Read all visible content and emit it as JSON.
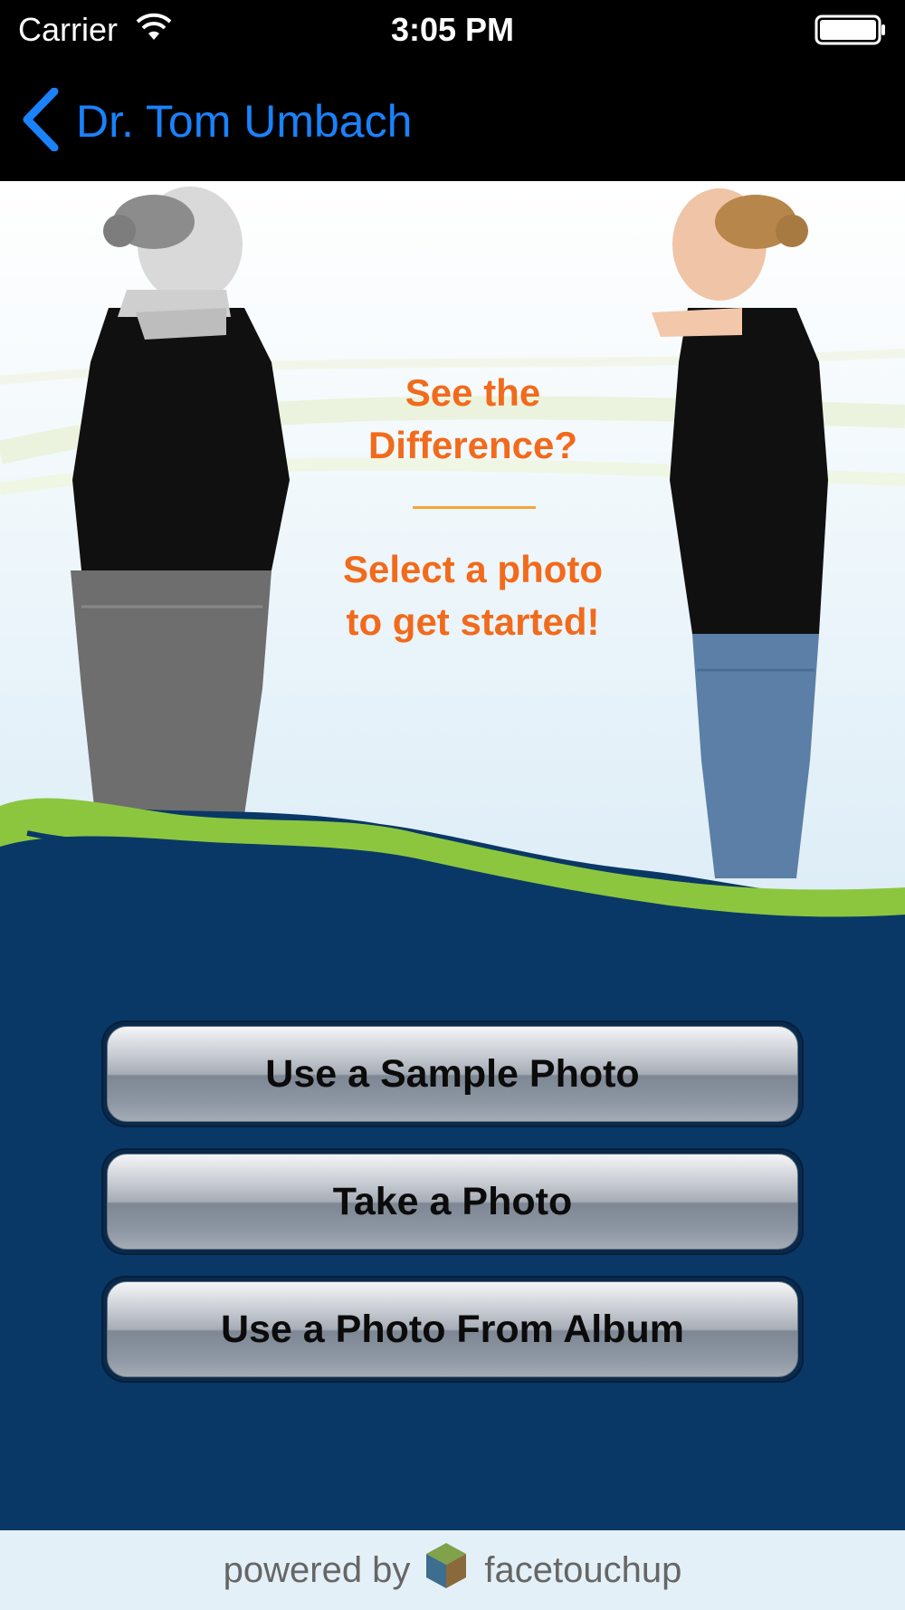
{
  "status_bar": {
    "carrier": "Carrier",
    "time": "3:05 PM",
    "wifi_icon": "wifi-icon",
    "battery_icon": "battery-icon"
  },
  "nav": {
    "back_label": "Dr. Tom Umbach",
    "back_icon": "chevron-left-icon",
    "accent_color": "#1a82fb"
  },
  "hero": {
    "title_line1": "See the",
    "title_line2": "Difference?",
    "subtitle_line1": "Select a photo",
    "subtitle_line2": "to get started!",
    "text_color": "#f26a1b"
  },
  "actions": {
    "sample_label": "Use a Sample Photo",
    "take_label": "Take a Photo",
    "album_label": "Use a Photo From Album"
  },
  "footer": {
    "powered_by": "powered by",
    "brand": "facetouchup"
  },
  "colors": {
    "panel_background": "#0a3866",
    "grass": "#8cc63f"
  }
}
